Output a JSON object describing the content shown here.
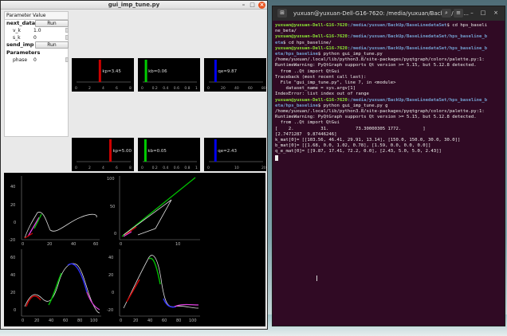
{
  "left_window": {
    "title": "gui_imp_tune.py",
    "btn_min": "–",
    "btn_max": "□",
    "btn_close": "×"
  },
  "param_tree": {
    "col_param": "Parameter",
    "col_value": "Value",
    "next_data": "next_data",
    "run1": "Run",
    "v_k_label": "v_k",
    "v_k_value": "1.0",
    "s_k_label": "s_k",
    "s_k_value": "0",
    "send_imp": "send_imp",
    "run2": "Run",
    "parameters": "Parameters",
    "phase_label": "phase",
    "phase_value": "0"
  },
  "small_plots": {
    "row1": [
      {
        "label": "kp=3.45",
        "ticks": [
          "0",
          "2",
          "4",
          "6",
          "8"
        ],
        "bar_color": "#cc0000",
        "value": 3.45,
        "xmax": 8
      },
      {
        "label": "kb=0.06",
        "ticks": [
          "0",
          "0.2",
          "0.4",
          "0.6",
          "0.8",
          "1"
        ],
        "bar_color": "#00cc00",
        "value": 0.06,
        "xmax": 1
      },
      {
        "label": "qe=9.87",
        "ticks": [
          "0",
          "20",
          "40",
          "60",
          "80"
        ],
        "bar_color": "#0000ee",
        "value": 9.87,
        "xmax": 80
      }
    ],
    "row2": [
      {
        "label": "kp=5.00",
        "ticks": [
          "0",
          "2",
          "4",
          "6",
          "8"
        ],
        "bar_color": "#cc0000",
        "value": 5.0,
        "xmax": 8
      },
      {
        "label": "kb=0.05",
        "ticks": [
          "0",
          "0.2",
          "0.4",
          "0.6",
          "0.8",
          "1"
        ],
        "bar_color": "#00cc00",
        "value": 0.05,
        "xmax": 1
      },
      {
        "label": "qe=2.43",
        "ticks": [
          "0",
          "10",
          "20"
        ],
        "bar_color": "#0000ee",
        "value": 2.43,
        "xmax": 20
      }
    ]
  },
  "big_plots": {
    "p1_y_ticks": [
      "40",
      "20",
      "0",
      "-20"
    ],
    "p1_x_ticks": [
      "0",
      "20",
      "40",
      "60"
    ],
    "p2_y_ticks": [
      "100",
      "50",
      "0"
    ],
    "p2_x_ticks": [
      "0",
      "10"
    ],
    "p3_y_ticks": [
      "60",
      "40",
      "20",
      "0"
    ],
    "p3_x_ticks": [
      "0",
      "20",
      "40",
      "60",
      "80",
      "100"
    ],
    "p4_y_ticks": [
      "40",
      "20",
      "0",
      "-20"
    ],
    "p4_x_ticks": [
      "0",
      "20",
      "40",
      "60",
      "80",
      "100"
    ]
  },
  "terminal": {
    "title": "yuxuan@yuxuan-Dell-G16-7620: /media/yuxuan/BackUp/Bas...",
    "btn_search": "⌕",
    "btn_menu": "≡",
    "btn_min": "–",
    "btn_max": "□",
    "btn_close": "×",
    "lines": [
      {
        "user": "yuxuan@yuxuan-Dell-G16-7620",
        "path": ":/media/yuxuan/BackUp/BaseLinedataSet",
        "cmd": "$ cd hps_baseli"
      },
      {
        "text": "ne_beta/"
      },
      {
        "user": "yuxuan@yuxuan-Dell-G16-7620",
        "path": ":/media/yuxuan/BackUp/BaseLinedataSet/hps_baseline_b",
        "cmd": ""
      },
      {
        "path": "eta",
        "cmd": "$ cd hps_baseline/"
      },
      {
        "user": "yuxuan@yuxuan-Dell-G16-7620",
        "path": ":/media/yuxuan/BackUp/BaseLinedataSet/hps_baseline_b",
        "cmd": ""
      },
      {
        "path": "eta/hps_baseline",
        "cmd": "$ python gui_imp_tune.py"
      },
      {
        "text": "/home/yuxuan/.local/lib/python3.8/site-packages/pyqtgraph/colors/palette.py:1:"
      },
      {
        "text": "RuntimeWarning: PyQtGraph supports Qt version >= 5.15, but 5.12.8 detected."
      },
      {
        "text": "  from ..Qt import QtGui"
      },
      {
        "text": "Traceback (most recent call last):"
      },
      {
        "text": "  File \"gui_imp_tune.py\", line 7, in <module>"
      },
      {
        "text": "    dataset_name = sys.argv[1]"
      },
      {
        "text": "IndexError: list index out of range"
      },
      {
        "user": "yuxuan@yuxuan-Dell-G16-7620",
        "path": ":/media/yuxuan/BackUp/BaseLinedataSet/hps_baseline_b",
        "cmd": ""
      },
      {
        "path": "eta/hps_baseline",
        "cmd": "$ python gui_imp_tune.py g"
      },
      {
        "text": "/home/yuxuan/.local/lib/python3.8/site-packages/pyqtgraph/colors/palette.py:1:"
      },
      {
        "text": "RuntimeWarning: PyQtGraph supports Qt version >= 5.15, but 5.12.8 detected."
      },
      {
        "text": "  from ..Qt import QtGui"
      },
      {
        "text": "[    2.          31.          73.30000305 1772.        ]"
      },
      {
        "text": "[2.7471287  9.87446246]"
      },
      {
        "text": "k_mat[0]= [[103.56, 46.41, 29.91, 13.14], [150.0, 150.0, 30.0, 30.0]]"
      },
      {
        "text": "b_mat[0]= [[1.68, 0.0, 1.02, 0.78], [1.59, 0.0, 0.0, 0.0]]"
      },
      {
        "text": "q_e_mat[0]= [[9.87, 17.41, 72.2, 0.0], [2.43, 5.0, 5.0, 2.43]]"
      }
    ]
  }
}
